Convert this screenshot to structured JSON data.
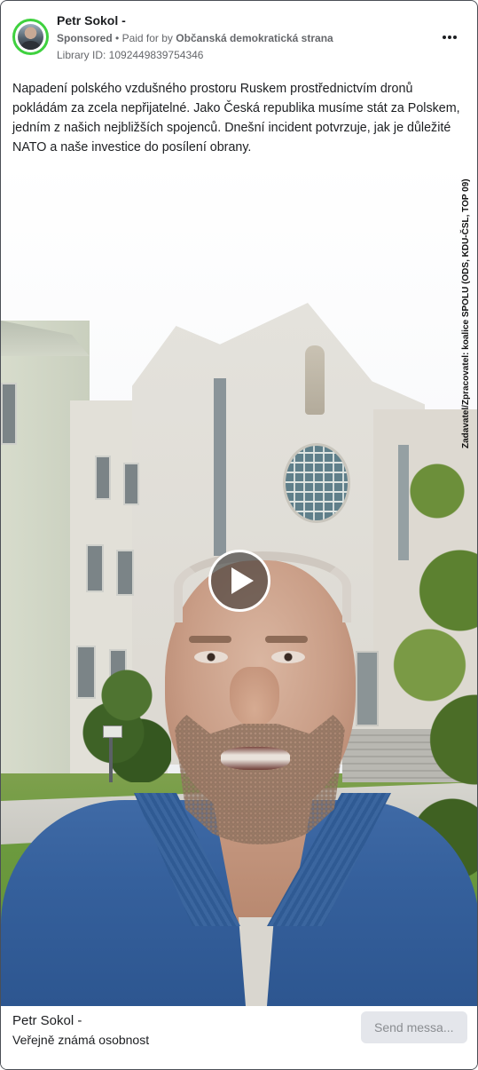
{
  "header": {
    "page_name": "Petr Sokol -",
    "sponsored_label": "Sponsored",
    "separator": "•",
    "paid_for_by_label": "Paid for by",
    "payer": "Občanská demokratická strana",
    "library_id": "Library ID: 1092449839754346",
    "more_icon": "more-horizontal-icon"
  },
  "post": {
    "caption": "Napadení polského vzdušného prostoru Ruskem prostřednictvím dronů pokládám za zcela nepřijatelné. Jako Česká republika musíme stát za Polskem, jedním z našich nejbližších spojenců. Dnešní incident potvrzuje, jak je důležité NATO a naše investice do posílení obrany."
  },
  "video": {
    "disclaimer": "Zadavatel/Zpracovatel: koalice SPOLU (ODS, KDU-ČSL, TOP 09)",
    "play_icon": "play-icon"
  },
  "footer": {
    "name": "Petr Sokol -",
    "category": "Veřejně známá osobnost",
    "send_button_label": "Send messa..."
  }
}
